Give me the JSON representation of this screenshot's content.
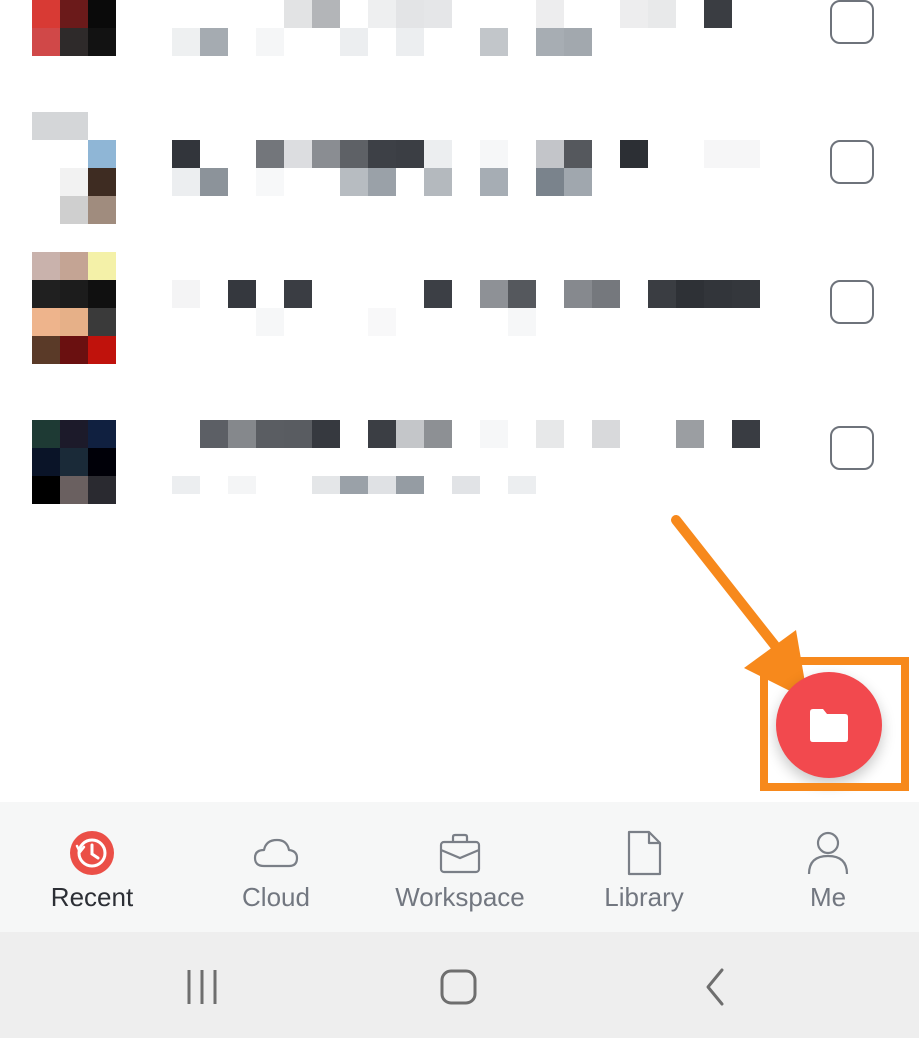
{
  "file_list": {
    "items": [
      {
        "thumb": [
          "#d83a34",
          "#6b1a1a",
          "#0a0a0a",
          "#d04848",
          "#2e2a2a",
          "#121212"
        ],
        "title_blocks": [
          {
            "c": "#ffffff"
          },
          {
            "c": "#ffffff"
          },
          {
            "c": "#ffffff"
          },
          {
            "c": "#ffffff"
          },
          {
            "c": "#e2e3e4"
          },
          {
            "c": "#b3b5b8"
          },
          {
            "c": "#ffffff"
          },
          {
            "c": "#eeeff0"
          },
          {
            "c": "#e3e4e6"
          },
          {
            "c": "#e5e6e8"
          },
          {
            "c": "#ffffff"
          },
          {
            "c": "#ffffff"
          },
          {
            "c": "#ffffff"
          },
          {
            "c": "#ededee"
          },
          {
            "c": "#ffffff"
          },
          {
            "c": "#ffffff"
          },
          {
            "c": "#ededee"
          },
          {
            "c": "#e8e9ea"
          },
          {
            "c": "#ffffff"
          },
          {
            "c": "#3a3d42"
          }
        ],
        "sub_blocks": [
          {
            "c": "#eef0f1"
          },
          {
            "c": "#a5abb1"
          },
          {
            "c": "#ffffff"
          },
          {
            "c": "#f5f6f7"
          },
          {
            "c": "#ffffff"
          },
          {
            "c": "#ffffff"
          },
          {
            "c": "#eceef0"
          },
          {
            "c": "#ffffff"
          },
          {
            "c": "#eceef0"
          },
          {
            "c": "#ffffff"
          },
          {
            "c": "#ffffff"
          },
          {
            "c": "#c2c6ca"
          },
          {
            "c": "#ffffff"
          },
          {
            "c": "#a7adb3"
          },
          {
            "c": "#a2a8ae"
          }
        ]
      },
      {
        "thumb": [
          "#d4d6d8",
          "#d4d6d8",
          "#ffffff",
          "#ffffff",
          "#ffffff",
          "#8fb6d6",
          "#ffffff",
          "#f2f2f2",
          "#3e2c22",
          "#ffffff",
          "#cfcfcf",
          "#a08c7e"
        ],
        "title_blocks": [
          {
            "c": "#32353b"
          },
          {
            "c": "#ffffff"
          },
          {
            "c": "#ffffff"
          },
          {
            "c": "#73767b"
          },
          {
            "c": "#dcdde0"
          },
          {
            "c": "#8a8d92"
          },
          {
            "c": "#5e6166"
          },
          {
            "c": "#3d4046"
          },
          {
            "c": "#3b3e44"
          },
          {
            "c": "#eceef0"
          },
          {
            "c": "#ffffff"
          },
          {
            "c": "#f6f7f8"
          },
          {
            "c": "#ffffff"
          },
          {
            "c": "#c3c5c9"
          },
          {
            "c": "#55585d"
          },
          {
            "c": "#ffffff"
          },
          {
            "c": "#2c2f34"
          },
          {
            "c": "#ffffff"
          },
          {
            "c": "#ffffff"
          },
          {
            "c": "#f6f6f7"
          },
          {
            "c": "#f6f6f7"
          }
        ],
        "sub_blocks": [
          {
            "c": "#eceef0"
          },
          {
            "c": "#8c939a"
          },
          {
            "c": "#ffffff"
          },
          {
            "c": "#f7f8f9"
          },
          {
            "c": "#ffffff"
          },
          {
            "c": "#ffffff"
          },
          {
            "c": "#b7bcc1"
          },
          {
            "c": "#9aa1a8"
          },
          {
            "c": "#ffffff"
          },
          {
            "c": "#b4b9be"
          },
          {
            "c": "#ffffff"
          },
          {
            "c": "#a6adb4"
          },
          {
            "c": "#ffffff"
          },
          {
            "c": "#7a838c"
          },
          {
            "c": "#a0a7ae"
          }
        ]
      },
      {
        "thumb": [
          "#c9b2ac",
          "#c4a494",
          "#f4f1a8",
          "#202020",
          "#1c1c1c",
          "#101010",
          "#eeb48c",
          "#e6b088",
          "#3a3a3a",
          "#5a3a28",
          "#6a1010",
          "#c0120c"
        ],
        "title_blocks": [
          {
            "c": "#f4f4f5"
          },
          {
            "c": "#ffffff"
          },
          {
            "c": "#35383e"
          },
          {
            "c": "#ffffff"
          },
          {
            "c": "#3a3d43"
          },
          {
            "c": "#ffffff"
          },
          {
            "c": "#ffffff"
          },
          {
            "c": "#ffffff"
          },
          {
            "c": "#ffffff"
          },
          {
            "c": "#3c3f45"
          },
          {
            "c": "#ffffff"
          },
          {
            "c": "#8e9196"
          },
          {
            "c": "#55585d"
          },
          {
            "c": "#ffffff"
          },
          {
            "c": "#86898e"
          },
          {
            "c": "#75787d"
          },
          {
            "c": "#ffffff"
          },
          {
            "c": "#3a3d42"
          },
          {
            "c": "#2e3136"
          },
          {
            "c": "#32353a"
          },
          {
            "c": "#34373c"
          }
        ],
        "sub_blocks": [
          {
            "c": "#ffffff"
          },
          {
            "c": "#ffffff"
          },
          {
            "c": "#ffffff"
          },
          {
            "c": "#f6f7f8"
          },
          {
            "c": "#ffffff"
          },
          {
            "c": "#ffffff"
          },
          {
            "c": "#ffffff"
          },
          {
            "c": "#f8f8f9"
          },
          {
            "c": "#ffffff"
          },
          {
            "c": "#ffffff"
          },
          {
            "c": "#ffffff"
          },
          {
            "c": "#ffffff"
          },
          {
            "c": "#f6f7f8"
          },
          {
            "c": "#ffffff"
          },
          {
            "c": "#ffffff"
          }
        ]
      },
      {
        "thumb": [
          "#1e3a34",
          "#1c1a2a",
          "#102040",
          "#0a1428",
          "#1a2a38",
          "#000008",
          "#000000",
          "#6a6060",
          "#2a2a30"
        ],
        "title_blocks": [
          {
            "c": "#ffffff"
          },
          {
            "c": "#5c5f65"
          },
          {
            "c": "#85888c"
          },
          {
            "c": "#5a5d62"
          },
          {
            "c": "#595c61"
          },
          {
            "c": "#36393f"
          },
          {
            "c": "#ffffff"
          },
          {
            "c": "#3b3e44"
          },
          {
            "c": "#c4c6c9"
          },
          {
            "c": "#8d9094"
          },
          {
            "c": "#ffffff"
          },
          {
            "c": "#f6f7f8"
          },
          {
            "c": "#ffffff"
          },
          {
            "c": "#e7e8e9"
          },
          {
            "c": "#ffffff"
          },
          {
            "c": "#d8d9db"
          },
          {
            "c": "#ffffff"
          },
          {
            "c": "#ffffff"
          },
          {
            "c": "#9b9ea2"
          },
          {
            "c": "#ffffff"
          },
          {
            "c": "#393c42"
          }
        ],
        "sub_blocks": [
          {
            "c": "#eceef0"
          },
          {
            "c": "#ffffff"
          },
          {
            "c": "#f4f5f6"
          },
          {
            "c": "#ffffff"
          },
          {
            "c": "#ffffff"
          },
          {
            "c": "#e4e6e8"
          },
          {
            "c": "#9aa1a8"
          },
          {
            "c": "#dfe1e4"
          },
          {
            "c": "#959ca3"
          },
          {
            "c": "#ffffff"
          },
          {
            "c": "#e1e3e6"
          },
          {
            "c": "#ffffff"
          },
          {
            "c": "#eceef0"
          },
          {
            "c": "#ffffff"
          },
          {
            "c": "#ffffff"
          }
        ]
      }
    ]
  },
  "fab": {
    "icon": "folder-icon",
    "color": "#f2494e"
  },
  "annotation": {
    "color": "#f7891c"
  },
  "bottom_nav": {
    "active_color": "#eb4f47",
    "items": [
      {
        "label": "Recent",
        "icon": "recent-clock-icon",
        "active": true
      },
      {
        "label": "Cloud",
        "icon": "cloud-icon",
        "active": false
      },
      {
        "label": "Workspace",
        "icon": "briefcase-icon",
        "active": false
      },
      {
        "label": "Library",
        "icon": "document-icon",
        "active": false
      },
      {
        "label": "Me",
        "icon": "person-icon",
        "active": false
      }
    ]
  },
  "system_nav": {
    "buttons": [
      "recents-apps-icon",
      "home-icon",
      "back-icon"
    ]
  }
}
